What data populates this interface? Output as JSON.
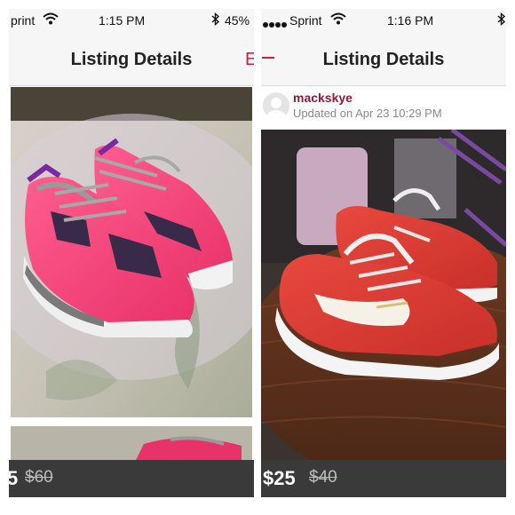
{
  "left": {
    "status": {
      "carrier": "print",
      "time": "1:15 PM",
      "battery": "45%"
    },
    "nav": {
      "title": "Listing Details",
      "edit_fragment": "E"
    },
    "price": {
      "current": "5",
      "original": "$60"
    }
  },
  "right": {
    "status": {
      "carrier": "Sprint",
      "time": "1:16 PM"
    },
    "nav": {
      "title": "Listing Details"
    },
    "seller": {
      "username": "mackskye",
      "updated": "Updated on Apr 23 10:29 PM"
    },
    "price": {
      "current": "$25",
      "original": "$40"
    }
  },
  "colors": {
    "brand": "#c7213f",
    "price_bar": "#3a3a3a"
  }
}
